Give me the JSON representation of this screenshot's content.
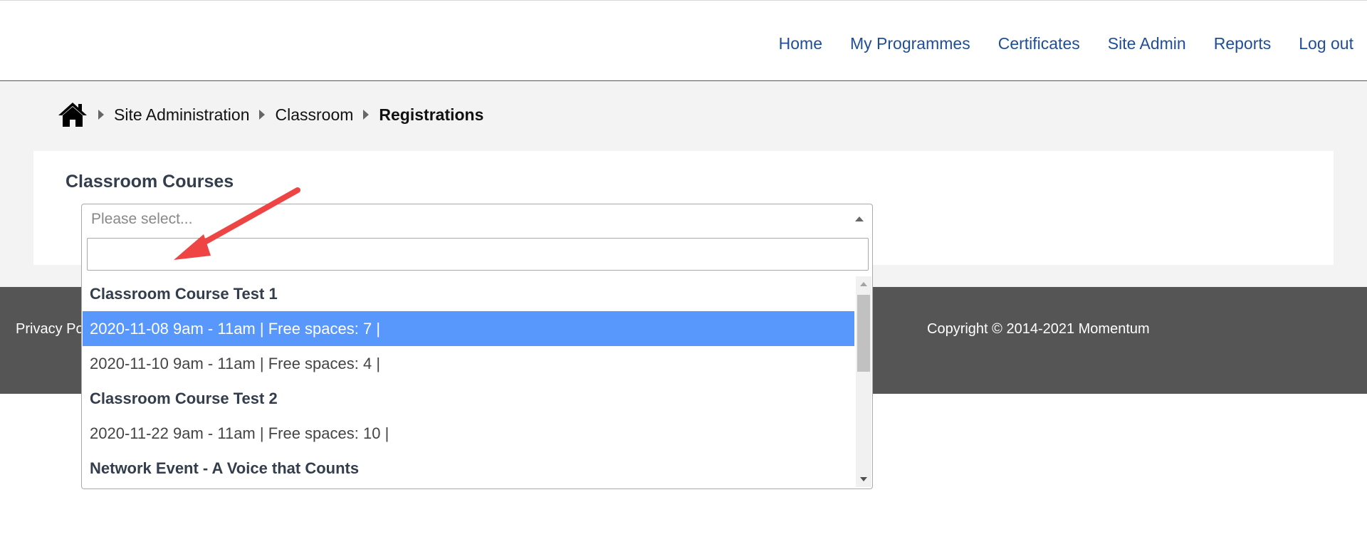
{
  "nav": {
    "items": [
      "Home",
      "My Programmes",
      "Certificates",
      "Site Admin",
      "Reports",
      "Log out"
    ]
  },
  "breadcrumb": {
    "items": [
      "Site Administration",
      "Classroom",
      "Registrations"
    ]
  },
  "panel": {
    "title": "Classroom Courses"
  },
  "select": {
    "placeholder": "Please select..."
  },
  "dropdown": {
    "search_value": "",
    "items": [
      {
        "type": "group",
        "label": "Classroom Course Test 1"
      },
      {
        "type": "option",
        "label": "2020-11-08 9am - 11am | Free spaces: 7 |",
        "highlighted": true
      },
      {
        "type": "option",
        "label": "2020-11-10 9am - 11am | Free spaces: 4 |"
      },
      {
        "type": "group",
        "label": "Classroom Course Test 2"
      },
      {
        "type": "option",
        "label": "2020-11-22 9am - 11am | Free spaces: 10 |"
      },
      {
        "type": "group",
        "label": "Network Event - A Voice that Counts"
      }
    ]
  },
  "footer": {
    "privacy": "Privacy Po",
    "copyright": "Copyright © 2014-2021 Momentum"
  },
  "colors": {
    "nav_link": "#1f4e99",
    "highlight": "#5897fb",
    "footer_bg": "#555555",
    "annotation_arrow": "#ef4444"
  }
}
